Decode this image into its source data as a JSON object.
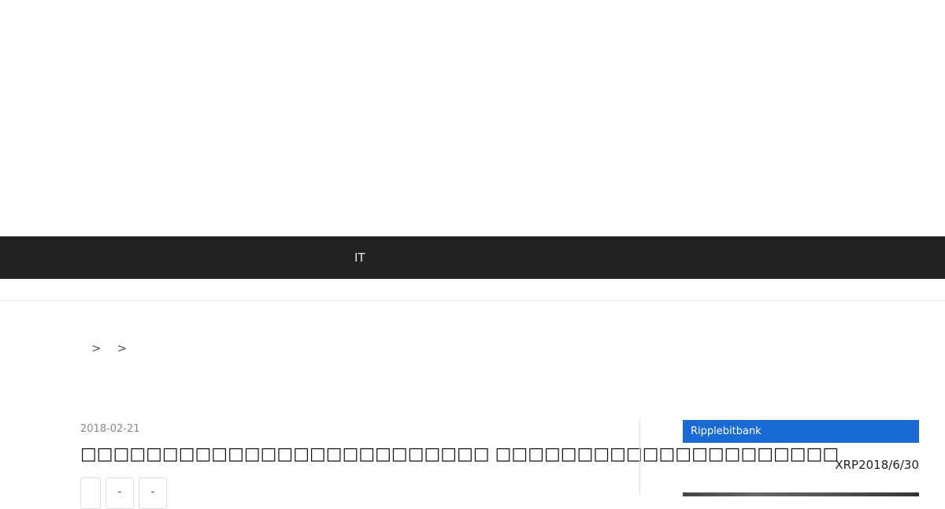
{
  "nav": {
    "items": [
      {
        "label": "IT"
      }
    ]
  },
  "breadcrumb": {
    "separator": ">",
    "items": [
      "",
      "",
      ""
    ]
  },
  "post": {
    "date": "2018-02-21",
    "title": "□□□□□□□□□□□□□□□□□□□□□□□□□ □□□□□□□□□□□□□□□□□□□□□",
    "share_buttons": [
      {
        "label": ""
      },
      {
        "label": "-"
      },
      {
        "label": "-"
      }
    ]
  },
  "sidebar": {
    "widget_title": "Ripplebitbank",
    "widget_text": "XRP2018/6/30"
  },
  "colors": {
    "navbar": "#222222",
    "accent": "#1a6ad4"
  }
}
